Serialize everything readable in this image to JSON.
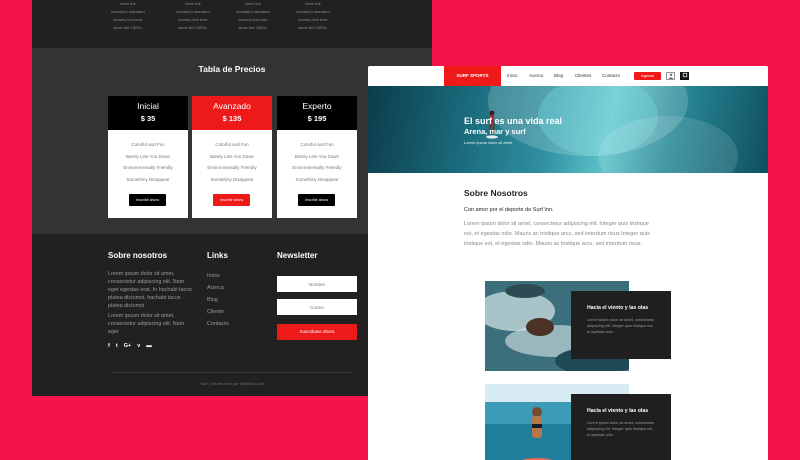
{
  "top_strip": {
    "columns": [
      {
        "lines": [
          "been the",
          "industry's standard",
          "dummy text ever",
          "since the 1500s."
        ]
      },
      {
        "lines": [
          "been the",
          "industry's standard",
          "dummy text ever",
          "since the 1500s."
        ]
      },
      {
        "lines": [
          "been the",
          "industry's standard",
          "dummy text ever",
          "since the 1500s."
        ]
      },
      {
        "lines": [
          "been the",
          "industry's standard",
          "dummy text ever",
          "since the 1500s."
        ]
      }
    ]
  },
  "pricing": {
    "title": "Tabla de Precios",
    "plans": [
      {
        "name": "Inicial",
        "price": "$ 35",
        "features": [
          "Colorful and Fun",
          "Barely Lets You Down",
          "Environmentally Friendly",
          "Somethiny Disappear"
        ],
        "button": "Inscribir ahora"
      },
      {
        "name": "Avanzado",
        "price": "$ 135",
        "features": [
          "Colorful and Fun",
          "Barely Lets You Down",
          "Environmentally Friendly",
          "Somethiny Disappear"
        ],
        "button": "Inscribir ahora"
      },
      {
        "name": "Experto",
        "price": "$ 195",
        "features": [
          "Colorful and Fun",
          "Barely Lets You Down",
          "Environmentally Friendly",
          "Somethiny Disappear"
        ],
        "button": "Inscribir ahora"
      }
    ]
  },
  "footer": {
    "about_heading": "Sobre nosotros",
    "about_p1": "Lorem ipsum dolor sit amet, consectetur adipiscing elit. Nam eget egestas erat. In hachabi tacce platea dictumst. hachabi tacce platea dictumst",
    "about_p2": "Lorem ipsum dolor sit amet, consectetur adipiscing elit. Nam eget",
    "social": {
      "facebook": "f",
      "twitter": "t",
      "google": "G+",
      "vimeo": "v",
      "youtube": "▬"
    },
    "links_heading": "Links",
    "links": [
      "Inicio",
      "Acerca",
      "Blog",
      "Cliente",
      "Contacto"
    ],
    "newsletter_heading": "Newsletter",
    "name_placeholder": "Nombre",
    "email_placeholder": "Correo",
    "subscribe_label": "Suscribase ahora",
    "copyright": "Surf | Diseño web por @MiltonCode"
  },
  "site": {
    "brand": "SURF SPORTS",
    "nav": [
      "Inicio",
      "Acerca",
      "Blog",
      "Clientes",
      "Contacto"
    ],
    "login_label": "Ingresar",
    "user_icon": "user-icon",
    "cart_icon": "cart-icon",
    "hero_title": "El surf es una vida real",
    "hero_subtitle": "Arena, mar y surf",
    "hero_small": "Lorem ipsum dolor sit amet",
    "about_title": "Sobre Nosotros",
    "about_lead": "Con amor por el deporte de Surf Inn.",
    "about_body": "Lorem ipsum dolor sit amet, consectetur adipiscing elit. Integer quis tristique est, et egestas odio. Mauris ac tristique arcu, sed interdum risus.Integer quis tristique est, et egestas odio. Mauris ac tristique arcu, sed interdum risus.",
    "cards": [
      {
        "title": "Hacia el viento y las olas",
        "text": "Lorem ipsum dolor sit amet, consectetur adipiscing elit. Integer quis tristique est, et egestas odio."
      },
      {
        "title": "Hacia el viento y las olas",
        "text": "Lorem ipsum dolor sit amet, consectetur adipiscing elit. Integer quis tristique est, et egestas odio."
      }
    ]
  },
  "colors": {
    "background": "#f5144a",
    "accent": "#ee1a1a",
    "dark": "#212121"
  }
}
